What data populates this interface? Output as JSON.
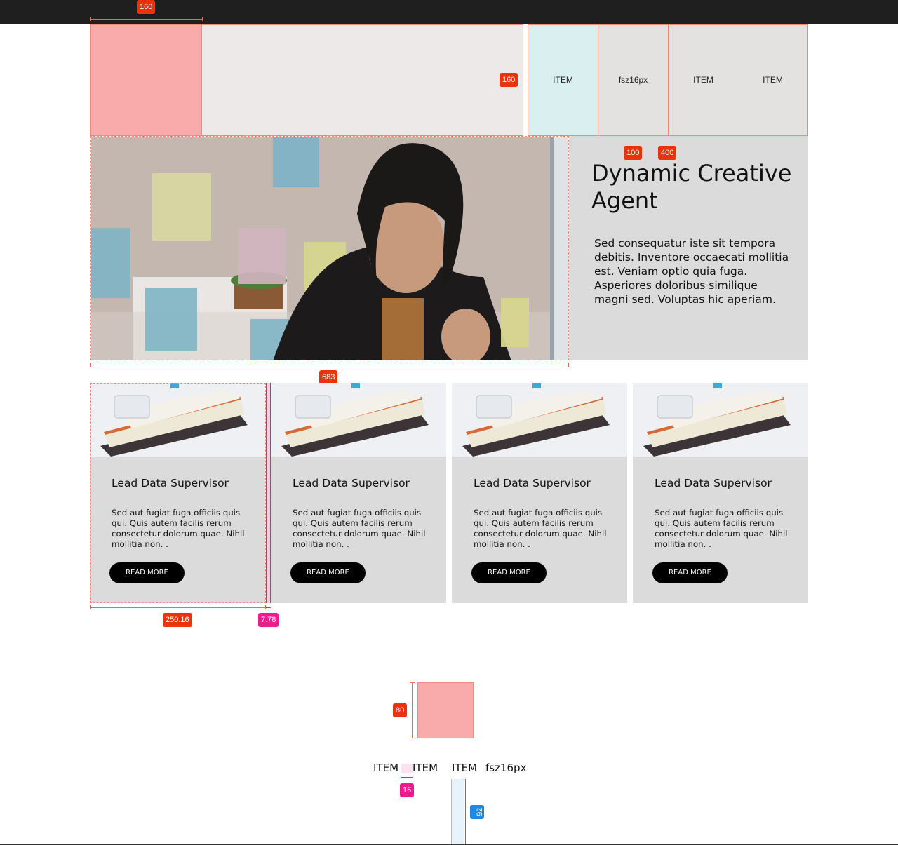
{
  "header": {
    "nav_items": [
      "ITEM",
      "fsz16px",
      "ITEM",
      "ITEM"
    ]
  },
  "hero": {
    "title": "Dynamic Creative Agent",
    "text": "Sed consequatur iste sit tempora debitis. Inventore occaecati mollitia est. Veniam optio quia fuga. Asperiores doloribus similique magni sed. Voluptas hic aperiam."
  },
  "cards": [
    {
      "title": "Lead Data Supervisor",
      "text": "Sed aut fugiat fuga officiis quis qui. Quis autem facilis rerum consectetur dolorum quae. Nihil mollitia non. .",
      "button": "READ MORE"
    },
    {
      "title": "Lead Data Supervisor",
      "text": "Sed aut fugiat fuga officiis quis qui. Quis autem facilis rerum consectetur dolorum quae. Nihil mollitia non. .",
      "button": "READ MORE"
    },
    {
      "title": "Lead Data Supervisor",
      "text": "Sed aut fugiat fuga officiis quis qui. Quis autem facilis rerum consectetur dolorum quae. Nihil mollitia non. .",
      "button": "READ MORE"
    },
    {
      "title": "Lead Data Supervisor",
      "text": "Sed aut fugiat fuga officiis quis qui. Quis autem facilis rerum consectetur dolorum quae. Nihil mollitia non. .",
      "button": "READ MORE"
    }
  ],
  "mobile_nav": {
    "items": [
      "ITEM",
      "ITEM",
      "ITEM",
      "fsz16px"
    ]
  },
  "measurements": {
    "logo_width": "160",
    "header_height": "160",
    "nav_item_width": "100",
    "nav_width": "400",
    "hero_image_width": "683",
    "card_width": "250.16",
    "card_gap": "7.78",
    "mobile_logo_size": "80",
    "mobile_nav_gap": "16",
    "mobile_nav_height": "92"
  },
  "colors": {
    "topbar": "#1f1f1f",
    "logo_placeholder": "#f9aaaa",
    "nav_active": "#d9eff0",
    "panel": "#dcdbdb",
    "button": "#000000",
    "measure_red": "#e8330d",
    "measure_pink": "#e91e8c",
    "measure_blue": "#1e88e5"
  }
}
